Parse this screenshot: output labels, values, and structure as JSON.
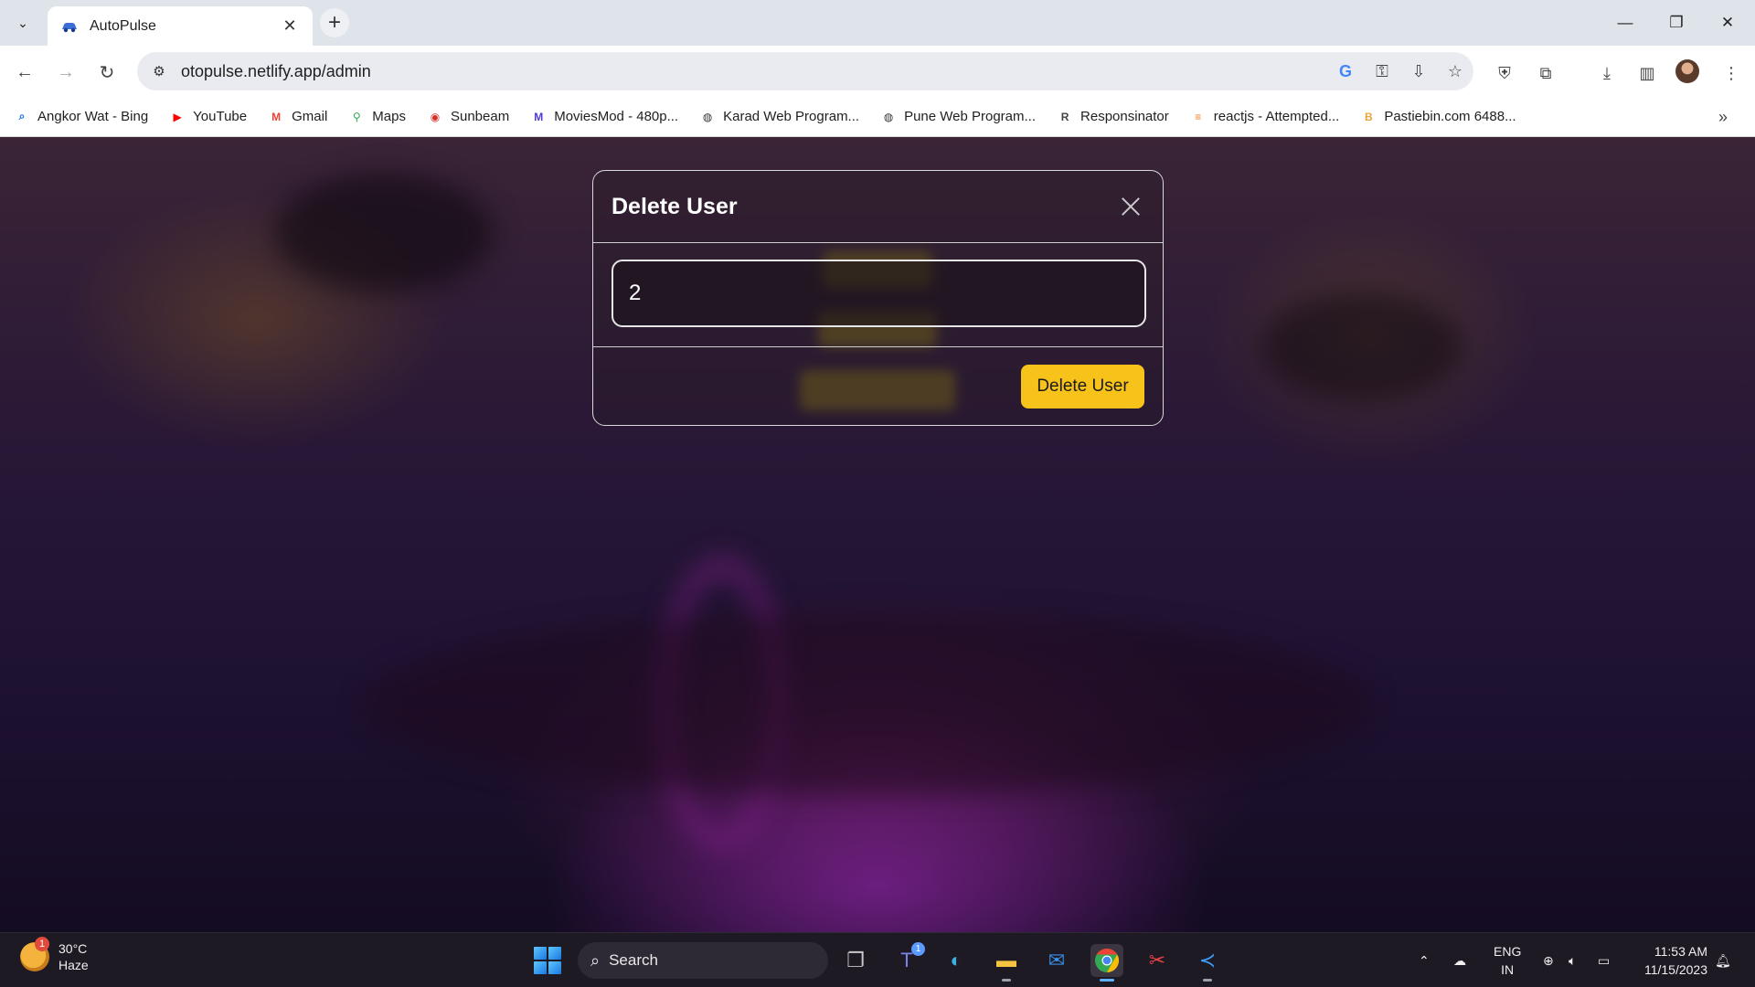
{
  "browser": {
    "tab": {
      "title": "AutoPulse"
    },
    "url": "otopulse.netlify.app/admin",
    "bookmarks": [
      {
        "label": "Angkor Wat - Bing",
        "icon": "search-icon",
        "color": "#1a73e8"
      },
      {
        "label": "YouTube",
        "icon": "youtube-icon",
        "color": "#ff0000"
      },
      {
        "label": "Gmail",
        "icon": "gmail-icon",
        "color": "#ea4335"
      },
      {
        "label": "Maps",
        "icon": "maps-pin-icon",
        "color": "#34a853"
      },
      {
        "label": "Sunbeam",
        "icon": "sunbeam-icon",
        "color": "#d93025"
      },
      {
        "label": "MoviesMod - 480p...",
        "icon": "moviesmod-icon",
        "color": "#4a3ad8"
      },
      {
        "label": "Karad Web Program...",
        "icon": "globe-icon",
        "color": "#333333"
      },
      {
        "label": "Pune Web Program...",
        "icon": "globe-icon",
        "color": "#333333"
      },
      {
        "label": "Responsinator",
        "icon": "responsinator-icon",
        "color": "#444444"
      },
      {
        "label": "reactjs - Attempted...",
        "icon": "stackoverflow-icon",
        "color": "#f48024"
      },
      {
        "label": "Pastiebin.com 6488...",
        "icon": "pastebin-icon",
        "color": "#e8a33a"
      }
    ]
  },
  "modal": {
    "title": "Delete User",
    "input_value": "2",
    "button_label": "Delete User",
    "accent_color": "#f7c31a"
  },
  "taskbar": {
    "weather": {
      "temp": "30°C",
      "condition": "Haze",
      "badge": "1"
    },
    "search_placeholder": "Search",
    "teams_badge": "1",
    "lang_line1": "ENG",
    "lang_line2": "IN",
    "time": "11:53 AM",
    "date": "11/15/2023"
  }
}
